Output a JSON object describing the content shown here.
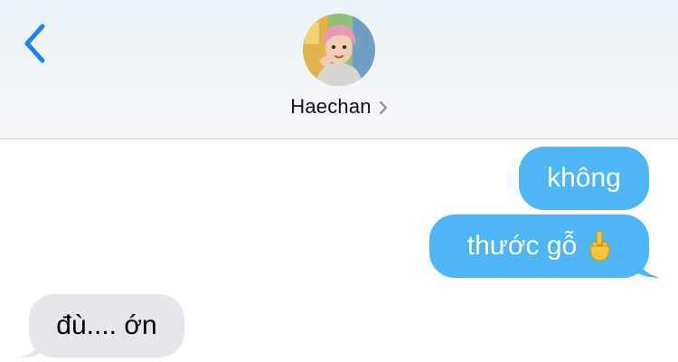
{
  "header": {
    "contact_name": "Haechan",
    "icons": {
      "back": "chevron-left-icon",
      "contact_details": "chevron-right-icon"
    }
  },
  "messages": [
    {
      "direction": "outgoing",
      "text": "không"
    },
    {
      "direction": "outgoing",
      "text": "thước gỗ",
      "emoji": "middle-finger-emoji"
    },
    {
      "direction": "incoming",
      "text": "đù.... ớn"
    }
  ],
  "colors": {
    "accent_blue": "#1a82fb",
    "outgoing_bubble": "#4fb6f5",
    "incoming_bubble": "#e6e6ea",
    "header_bg": "#eef3f7"
  }
}
